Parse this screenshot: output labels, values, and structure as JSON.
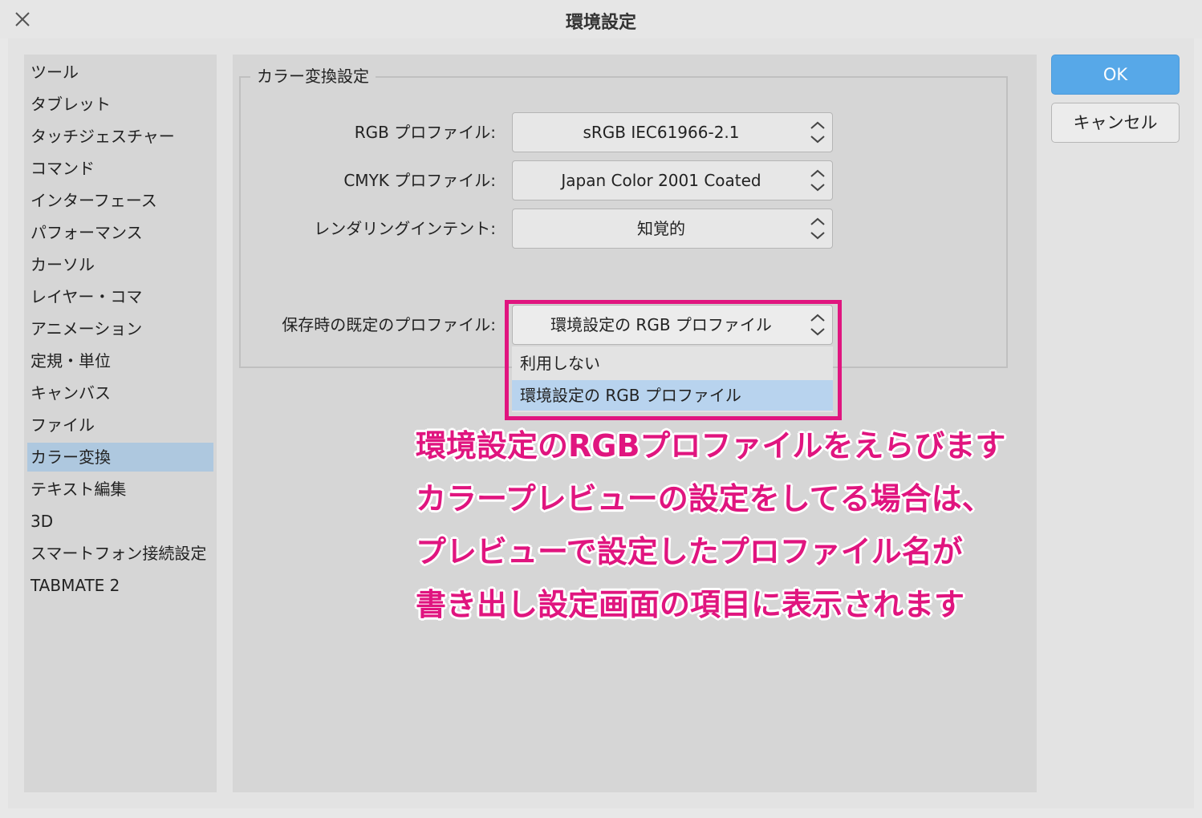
{
  "window": {
    "title": "環境設定"
  },
  "sidebar": {
    "selected_index": 12,
    "items": [
      {
        "label": "ツール"
      },
      {
        "label": "タブレット"
      },
      {
        "label": "タッチジェスチャー"
      },
      {
        "label": "コマンド"
      },
      {
        "label": "インターフェース"
      },
      {
        "label": "パフォーマンス"
      },
      {
        "label": "カーソル"
      },
      {
        "label": "レイヤー・コマ"
      },
      {
        "label": "アニメーション"
      },
      {
        "label": "定規・単位"
      },
      {
        "label": "キャンバス"
      },
      {
        "label": "ファイル"
      },
      {
        "label": "カラー変換"
      },
      {
        "label": "テキスト編集"
      },
      {
        "label": "3D"
      },
      {
        "label": "スマートフォン接続設定"
      },
      {
        "label": "TABMATE 2"
      }
    ]
  },
  "panel": {
    "group_title": "カラー変換設定",
    "rgb_profile": {
      "label": "RGB プロファイル:",
      "value": "sRGB IEC61966-2.1"
    },
    "cmyk_profile": {
      "label": "CMYK プロファイル:",
      "value": "Japan Color 2001 Coated"
    },
    "rendering_intent": {
      "label": "レンダリングインテント:",
      "value": "知覚的"
    },
    "default_profile": {
      "label": "保存時の既定のプロファイル:",
      "value": "環境設定の RGB プロファイル",
      "options": [
        "利用しない",
        "環境設定の RGB プロファイル"
      ],
      "selected_option_index": 1
    }
  },
  "buttons": {
    "ok": "OK",
    "cancel": "キャンセル"
  },
  "annotation": {
    "lines": [
      "環境設定のRGBプロファイルをえらびます",
      "カラープレビューの設定をしてる場合は、",
      "プレビューで設定したプロファイル名が",
      "書き出し設定画面の項目に表示されます"
    ]
  },
  "colors": {
    "accent": "#57a8e8",
    "selection": "#aec8df",
    "annotation": "#e0157f"
  },
  "icons": {
    "close": "close-icon",
    "stepper": "chevron-up-down-icon"
  }
}
